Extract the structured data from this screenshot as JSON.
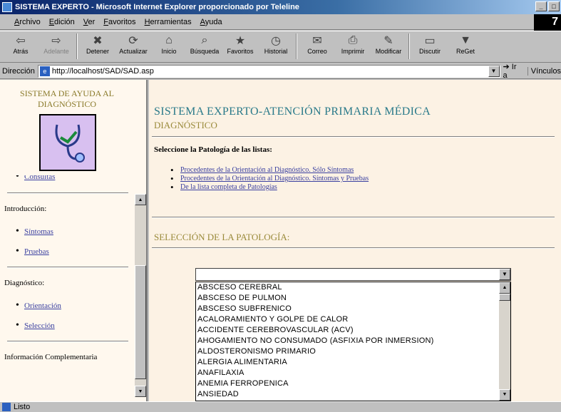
{
  "window": {
    "title": "SISTEMA EXPERTO - Microsoft Internet Explorer proporcionado por Teleline",
    "throbber_text": "7"
  },
  "menu": [
    "Archivo",
    "Edición",
    "Ver",
    "Favoritos",
    "Herramientas",
    "Ayuda"
  ],
  "toolbar": [
    {
      "label": "Atrás",
      "icon": "back-arrow-icon",
      "glyph": "⇦",
      "enabled": true
    },
    {
      "label": "Adelante",
      "icon": "forward-arrow-icon",
      "glyph": "⇨",
      "enabled": false
    },
    {
      "label": "Detener",
      "icon": "stop-icon",
      "glyph": "✖",
      "enabled": true
    },
    {
      "label": "Actualizar",
      "icon": "refresh-icon",
      "glyph": "⟳",
      "enabled": true
    },
    {
      "label": "Inicio",
      "icon": "home-icon",
      "glyph": "⌂",
      "enabled": true
    },
    {
      "label": "Búsqueda",
      "icon": "search-icon",
      "glyph": "⌕",
      "enabled": true
    },
    {
      "label": "Favoritos",
      "icon": "favorites-icon",
      "glyph": "★",
      "enabled": true
    },
    {
      "label": "Historial",
      "icon": "history-icon",
      "glyph": "◷",
      "enabled": true
    },
    {
      "label": "Correo",
      "icon": "mail-icon",
      "glyph": "✉",
      "enabled": true
    },
    {
      "label": "Imprimir",
      "icon": "print-icon",
      "glyph": "⎙",
      "enabled": true
    },
    {
      "label": "Modificar",
      "icon": "edit-icon",
      "glyph": "✎",
      "enabled": true
    },
    {
      "label": "Discutir",
      "icon": "discuss-icon",
      "glyph": "▭",
      "enabled": true
    },
    {
      "label": "ReGet",
      "icon": "reget-icon",
      "glyph": "▼",
      "enabled": true
    }
  ],
  "address": {
    "label": "Dirección",
    "url": "http://localhost/SAD/SAD.asp",
    "go_label": "Ir a",
    "links_label": "Vínculos"
  },
  "left": {
    "title": "SISTEMA DE AYUDA AL DIAGNÓSTICO",
    "logo_icon": "stethoscope-logo-icon",
    "cut_item": "Consultas",
    "intro_heading": "Introducción:",
    "intro_items": [
      "Síntomas",
      "Pruebas"
    ],
    "diag_heading": "Diagnóstico:",
    "diag_items": [
      "Orientación",
      "Selección"
    ],
    "info_heading": "Información Complementaria"
  },
  "main": {
    "title": "SISTEMA EXPERTO-ATENCIÓN PRIMARIA MÉDICA",
    "subtitle": "DIAGNÓSTICO",
    "instruction": "Seleccione la Patología de las listas:",
    "options": [
      "Procedentes de la Orientación al Diagnóstico. Sólo Síntomas",
      "Procedentes de la Orientación al Diagnóstico. Síntomas y Pruebas",
      "De la lista completa de Patologías"
    ],
    "section_title": "SELECCIÓN DE LA PATOLOGÍA:",
    "select_value": "",
    "pathologies": [
      "ABSCESO CEREBRAL",
      "ABSCESO DE PULMON",
      "ABSCESO SUBFRENICO",
      "ACALORAMIENTO Y GOLPE DE CALOR",
      "ACCIDENTE CEREBROVASCULAR (ACV)",
      "AHOGAMIENTO NO CONSUMADO (ASFIXIA POR INMERSION)",
      "ALDOSTERONISMO PRIMARIO",
      "ALERGIA ALIMENTARIA",
      "ANAFILAXIA",
      "ANEMIA FERROPENICA",
      "ANSIEDAD"
    ]
  },
  "status": {
    "text": "Listo"
  }
}
